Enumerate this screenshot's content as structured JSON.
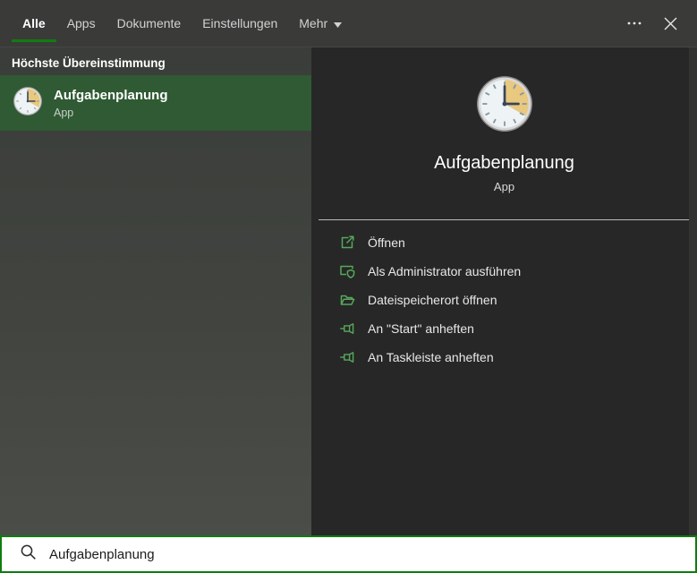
{
  "accent": {
    "green": "#107C10",
    "selection_green": "#2f5a33",
    "action_icon_green": "#57a85b",
    "search_border_green": "#0f7d0f"
  },
  "tabs": {
    "items": [
      {
        "label": "Alle",
        "active": true
      },
      {
        "label": "Apps",
        "active": false
      },
      {
        "label": "Dokumente",
        "active": false
      },
      {
        "label": "Einstellungen",
        "active": false
      },
      {
        "label": "Mehr",
        "active": false,
        "dropdown_icon": "chevron-down-icon"
      }
    ]
  },
  "topbar": {
    "icons": [
      "more-options-icon",
      "close-icon"
    ]
  },
  "left_panel": {
    "section_header": "Höchste Übereinstimmung",
    "result": {
      "title": "Aufgabenplanung",
      "subtitle": "App",
      "icon": "task-scheduler-clock-icon",
      "selected": true
    }
  },
  "right_panel": {
    "icon": "task-scheduler-clock-icon",
    "app_title": "Aufgabenplanung",
    "app_type": "App",
    "actions": [
      {
        "label": "Öffnen",
        "icon": "open-icon"
      },
      {
        "label": "Als Administrator ausführen",
        "icon": "admin-shield-icon"
      },
      {
        "label": "Dateispeicherort öffnen",
        "icon": "open-folder-icon"
      },
      {
        "label": "An \"Start\" anheften",
        "icon": "pin-icon"
      },
      {
        "label": "An Taskleiste anheften",
        "icon": "pin-icon"
      }
    ]
  },
  "search": {
    "icon": "search-icon",
    "value": "Aufgabenplanung"
  }
}
